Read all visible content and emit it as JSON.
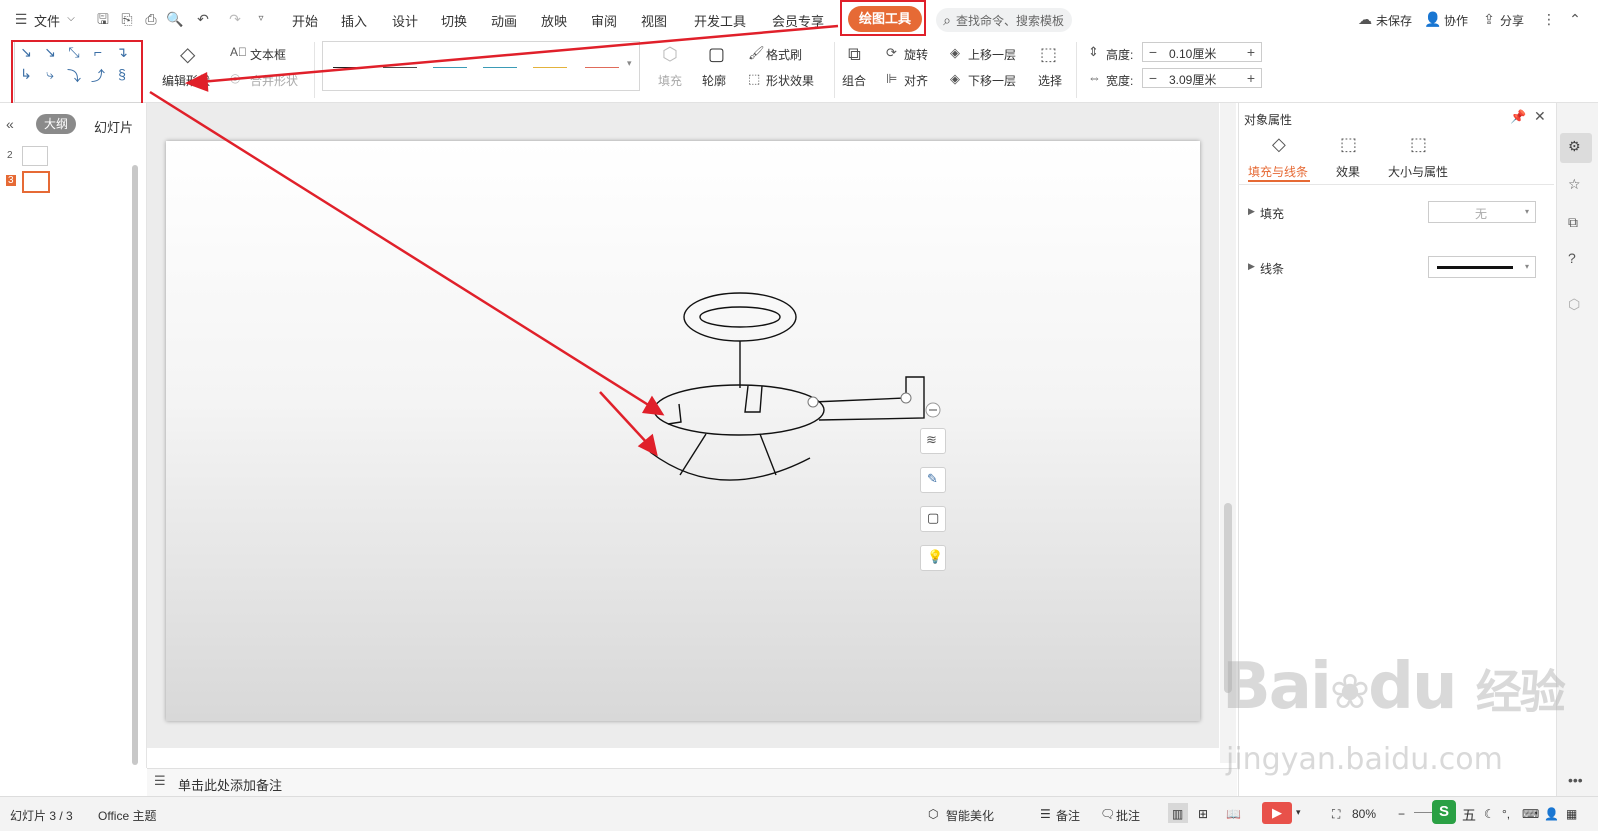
{
  "menu": {
    "file": "文件",
    "tabs": [
      "开始",
      "插入",
      "设计",
      "切换",
      "动画",
      "放映",
      "审阅",
      "视图",
      "开发工具",
      "会员专享"
    ],
    "active_tab": "绘图工具",
    "search_placeholder": "查找命令、搜索模板",
    "unsaved": "未保存",
    "collaborate": "协作",
    "share": "分享"
  },
  "ribbon": {
    "edit_shape": "编辑形状",
    "text_box": "文本框",
    "merge_shapes": "合并形状",
    "fill": "填充",
    "outline": "轮廓",
    "format_painter": "格式刷",
    "shape_effects": "形状效果",
    "group": "组合",
    "rotate": "旋转",
    "align": "对齐",
    "bring_forward": "上移一层",
    "send_backward": "下移一层",
    "select": "选择",
    "height_label": "高度:",
    "height_value": "0.10厘米",
    "width_label": "宽度:",
    "width_value": "3.09厘米",
    "style_line_colors": [
      "#222222",
      "#4a4a4a",
      "#3b9bb6",
      "#3b9bb6",
      "#e3b23c",
      "#e06b5a"
    ]
  },
  "left_panel": {
    "outline_tab": "大纲",
    "slides_tab": "幻灯片",
    "slide_numbers": [
      "2",
      "3"
    ]
  },
  "notes": {
    "placeholder": "单击此处添加备注"
  },
  "properties": {
    "title": "对象属性",
    "tabs": [
      "填充与线条",
      "效果",
      "大小与属性"
    ],
    "fill_label": "填充",
    "fill_value": "无",
    "line_label": "线条"
  },
  "status": {
    "slide_counter": "幻灯片 3 / 3",
    "theme": "Office 主题",
    "smart_beautify": "智能美化",
    "notes": "备注",
    "comments": "批注",
    "zoom": "80%"
  },
  "watermark": {
    "brand": "Bai",
    "brand_suffix": "经验",
    "url": "jingyan.baidu.com"
  },
  "colors": {
    "accent": "#e66a35",
    "highlight_red": "#e0202a"
  }
}
